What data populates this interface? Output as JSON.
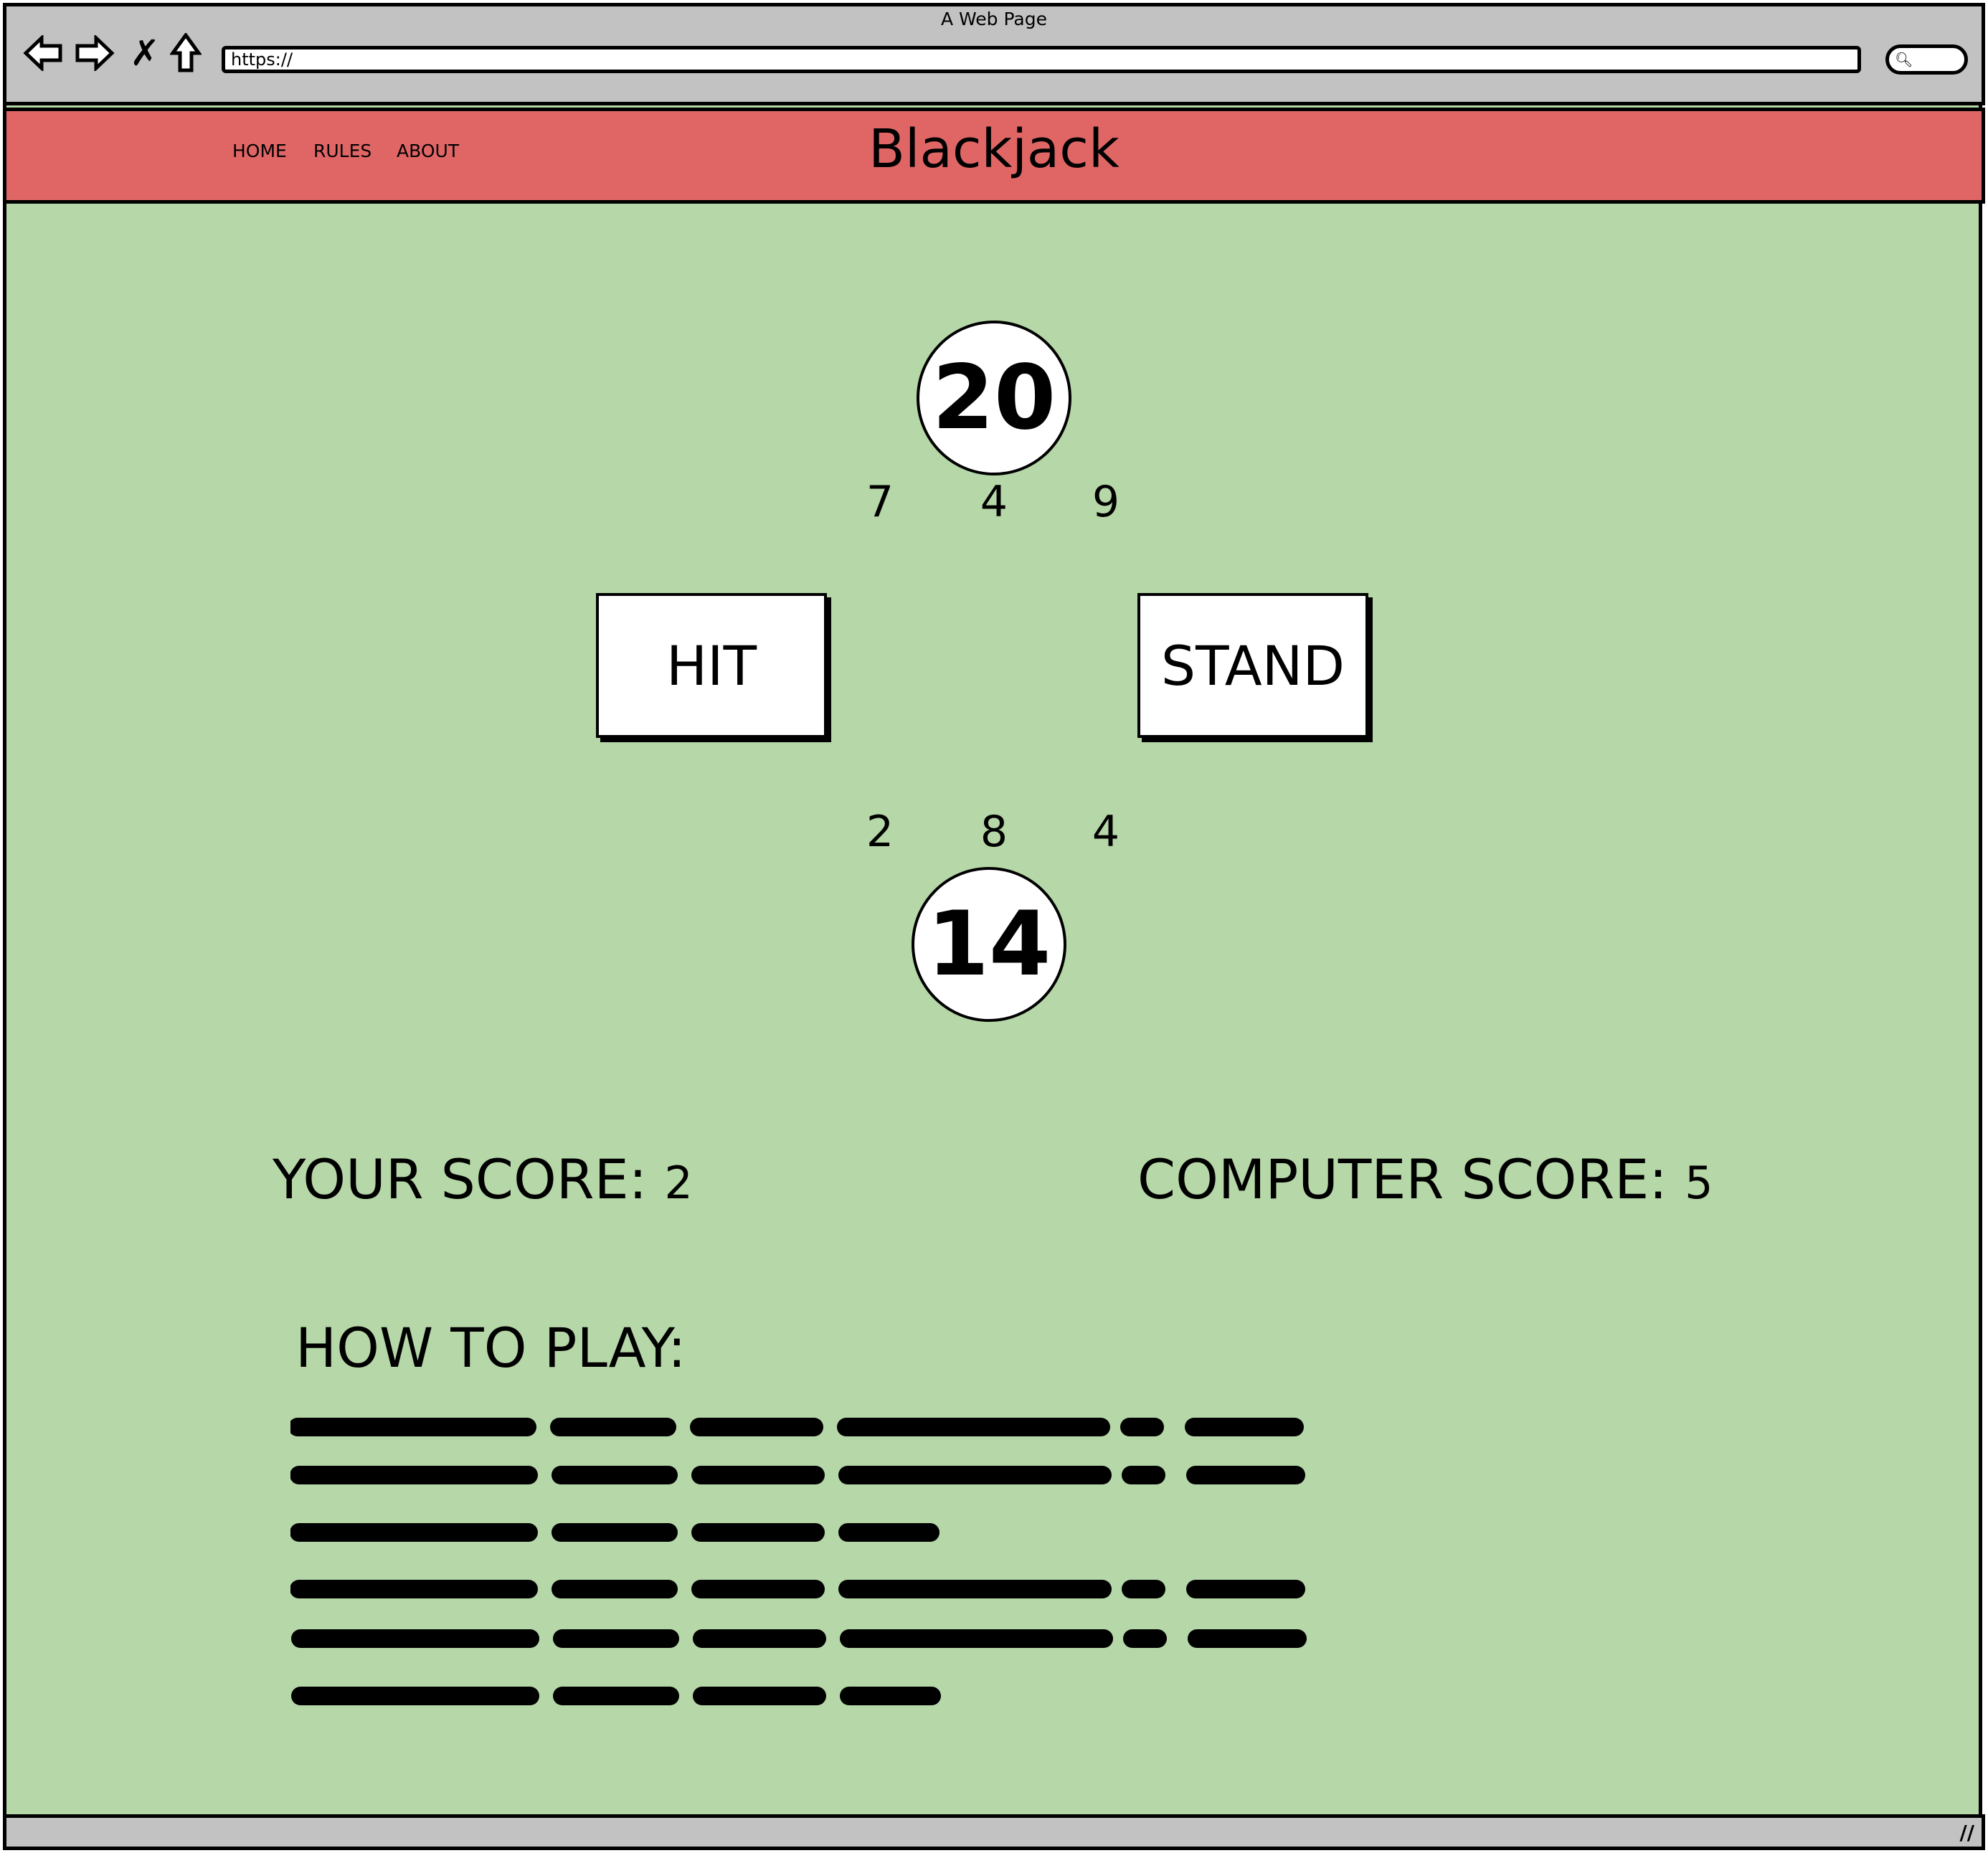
{
  "browser": {
    "window_title": "A Web Page",
    "url": "https://"
  },
  "header": {
    "brand": "Blackjack",
    "nav": [
      "HOME",
      "RULES",
      "ABOUT"
    ],
    "color": "#e06666"
  },
  "game": {
    "dealer_total": "20",
    "dealer_cards": [
      "7",
      "4",
      "9"
    ],
    "hit_label": "HIT",
    "stand_label": "STAND",
    "player_cards": [
      "2",
      "8",
      "4"
    ],
    "player_total": "14",
    "background": "#b6d7a8"
  },
  "scores": {
    "your_label": "YOUR SCORE:",
    "your_value": "2",
    "computer_label": "COMPUTER SCORE:",
    "computer_value": "5"
  },
  "howto": {
    "title": "HOW TO PLAY:"
  }
}
